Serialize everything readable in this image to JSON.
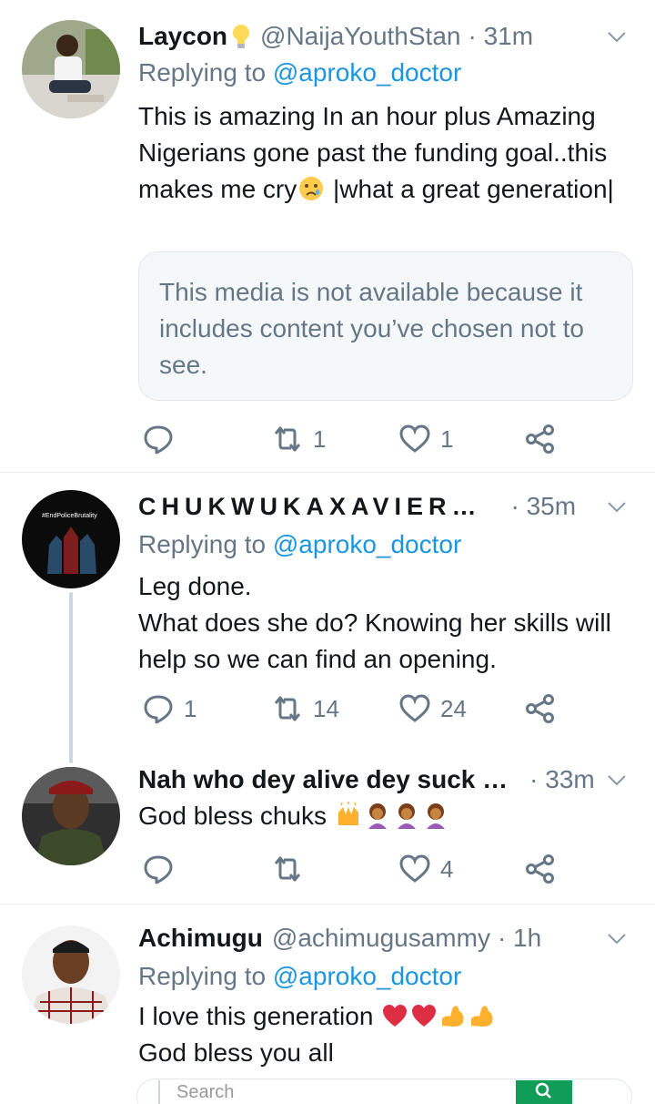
{
  "tweets": [
    {
      "name": "Laycon",
      "handle": "@NaijaYouthStan",
      "time": "· 31m",
      "replying_prefix": "Replying to",
      "replying_to": "@aproko_doctor",
      "text_a": "This is amazing In an hour plus Amazing Nigerians gone past the funding goal..this makes me cry",
      "text_b": "|what a great generation|",
      "media_notice": "This media is not available because it includes content you’ve chosen not to see.",
      "replies": "",
      "retweets": "1",
      "likes": "1"
    },
    {
      "name": "CHUKWUKAXAVIER…",
      "time": "· 35m",
      "replying_prefix": "Replying to",
      "replying_to": "@aproko_doctor",
      "line1": "Leg done.",
      "line2": "What does she do? Knowing her skills will help so we can find an opening.",
      "avatar_text": "#EndPoliceBrutality",
      "replies": "1",
      "retweets": "14",
      "likes": "24"
    },
    {
      "name": "Nah who dey alive dey suck …",
      "time": "· 33m",
      "text": "God bless chuks",
      "replies": "",
      "retweets": "",
      "likes": "4"
    },
    {
      "name": "Achimugu",
      "handle": "@achimugusammy",
      "time": "· 1h",
      "replying_prefix": "Replying to",
      "replying_to": "@aproko_doctor",
      "line1": "I love this generation",
      "line2": "God bless you all"
    }
  ],
  "search": {
    "placeholder": "Search"
  },
  "colors": {
    "link": "#1b95e0",
    "muted": "#657786",
    "text": "#14171a",
    "divider": "#e6ecf0",
    "search_button": "#0f9d58"
  },
  "icons": [
    "reply-icon",
    "retweet-icon",
    "like-icon",
    "share-icon",
    "chevron-down-icon",
    "lightbulb-icon",
    "crying-face-emoji",
    "raising-hands-emoji",
    "woman-facepalming-emoji",
    "red-heart-emoji",
    "flexed-biceps-emoji",
    "search-icon"
  ]
}
